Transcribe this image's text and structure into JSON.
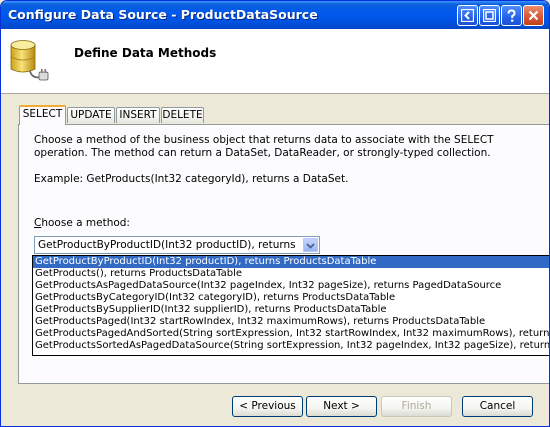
{
  "window": {
    "title": "Configure Data Source - ProductDataSource"
  },
  "header": {
    "title": "Define Data Methods"
  },
  "tabs": [
    {
      "label": "SELECT",
      "active": true
    },
    {
      "label": "UPDATE",
      "active": false
    },
    {
      "label": "INSERT",
      "active": false
    },
    {
      "label": "DELETE",
      "active": false
    }
  ],
  "panel": {
    "description": "Choose a method of the business object that returns data to associate with the SELECT operation. The method can return a DataSet, DataReader, or strongly-typed collection.",
    "example": "Example: GetProducts(Int32 categoryId), returns a DataSet.",
    "choose_label": "Choose a method:",
    "selected_method": "GetProductByProductID(Int32 productID), returns ProductsDataTable",
    "methods": [
      "GetProductByProductID(Int32 productID), returns ProductsDataTable",
      "GetProducts(), returns ProductsDataTable",
      "GetProductsAsPagedDataSource(Int32 pageIndex, Int32 pageSize), returns PagedDataSource",
      "GetProductsByCategoryID(Int32 categoryID), returns ProductsDataTable",
      "GetProductsBySupplierID(Int32 supplierID), returns ProductsDataTable",
      "GetProductsPaged(Int32 startRowIndex, Int32 maximumRows), returns ProductsDataTable",
      "GetProductsPagedAndSorted(String sortExpression, Int32 startRowIndex, Int32 maximumRows), returns ProductsDataTable",
      "GetProductsSortedAsPagedDataSource(String sortExpression, Int32 pageIndex, Int32 pageSize), returns PagedDataSource"
    ]
  },
  "buttons": {
    "previous": "< Previous",
    "next": "Next >",
    "finish": "Finish",
    "cancel": "Cancel"
  },
  "colors": {
    "titlebar": "#0054e3",
    "selection": "#316ac5",
    "dialog_bg": "#ece9d8",
    "active_tab_accent": "#f2a936"
  },
  "icons": [
    "database-icon",
    "help-icon",
    "close-icon",
    "restore-icon",
    "back-icon",
    "chevron-down-icon"
  ]
}
